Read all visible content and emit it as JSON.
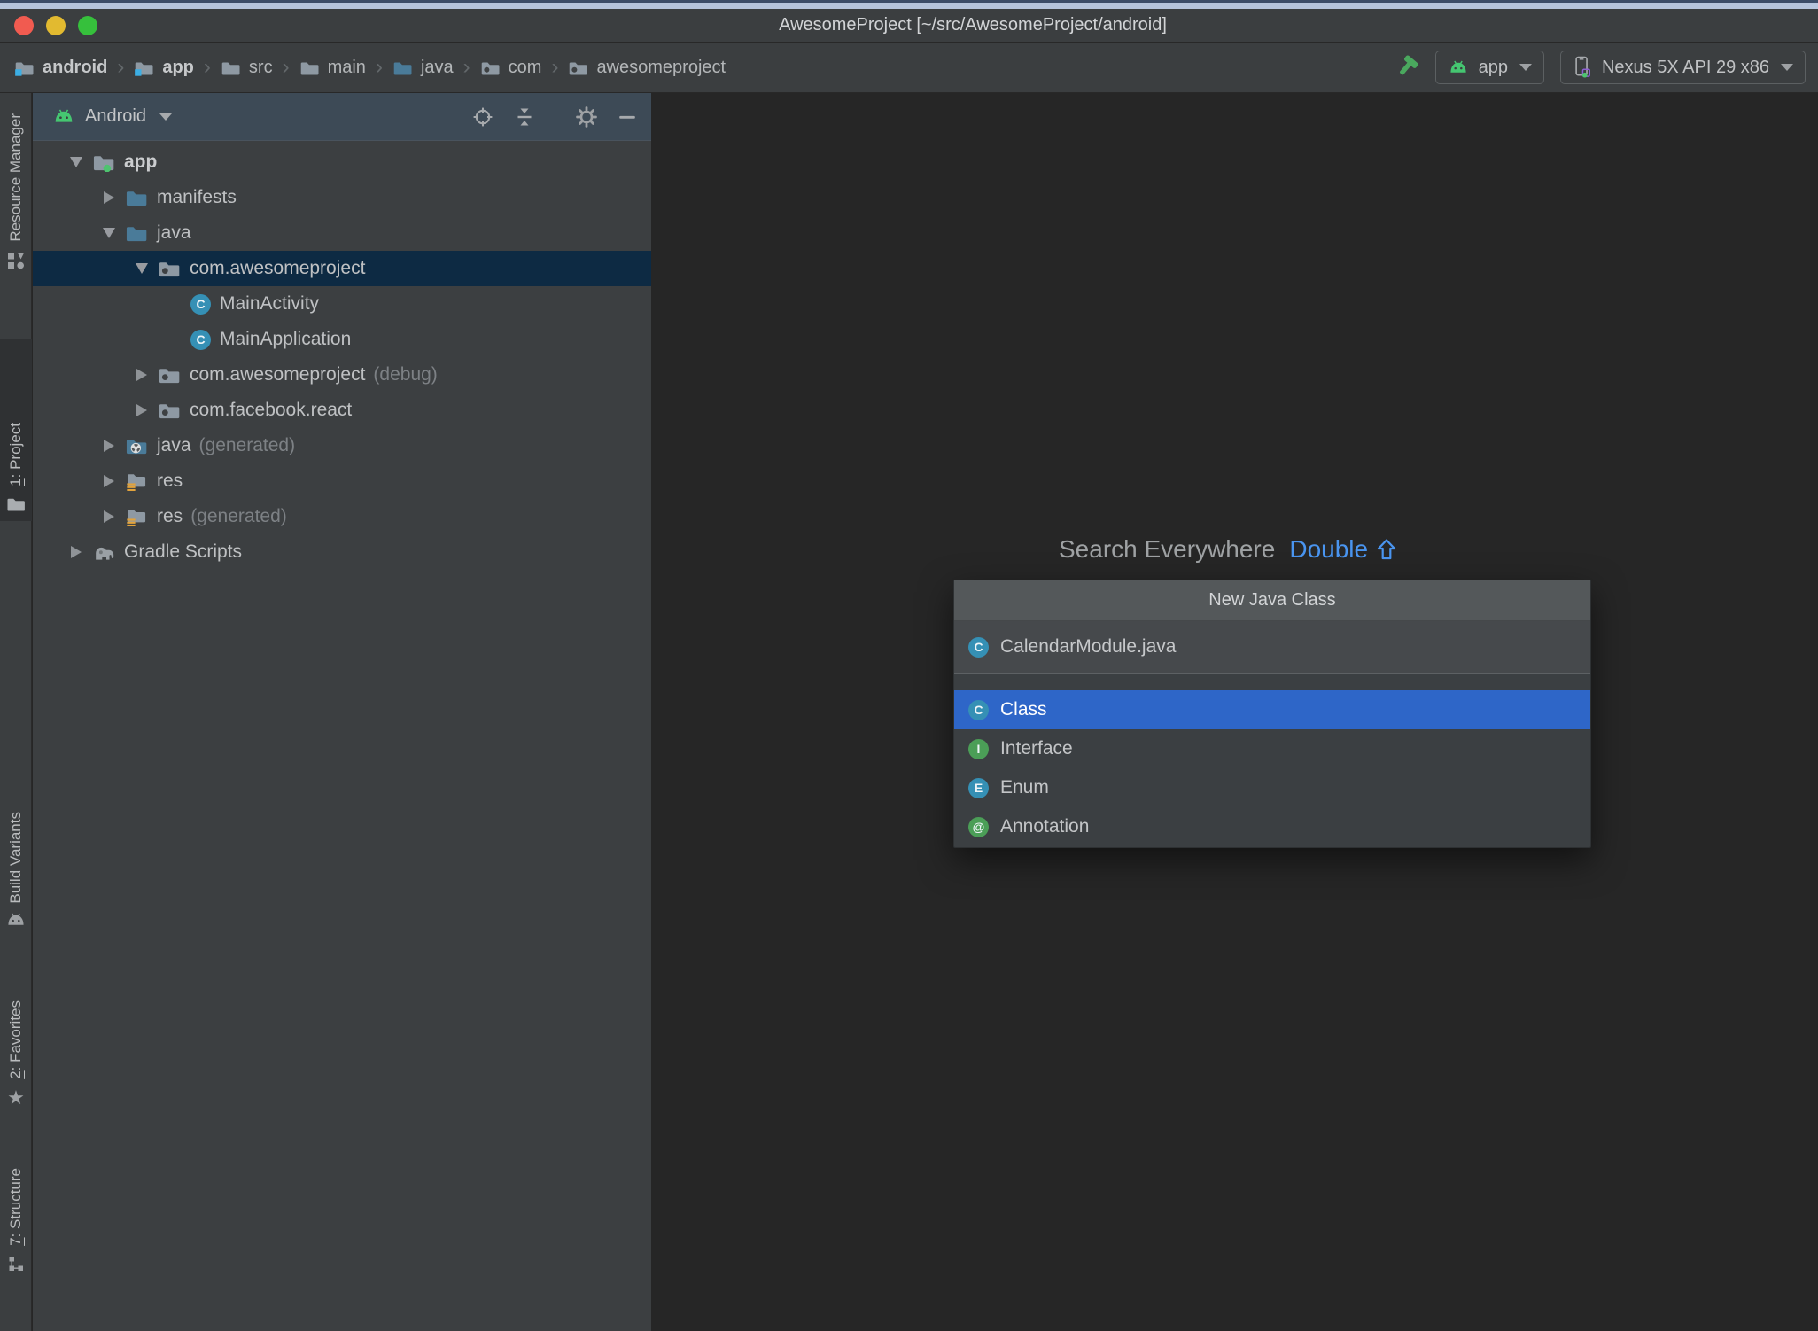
{
  "window": {
    "title": "AwesomeProject [~/src/AwesomeProject/android]"
  },
  "breadcrumb": {
    "separator": "›",
    "items": [
      {
        "label": "android",
        "icon": "folder-module",
        "bold": true
      },
      {
        "label": "app",
        "icon": "folder-module",
        "bold": true
      },
      {
        "label": "src",
        "icon": "folder-gray",
        "bold": false
      },
      {
        "label": "main",
        "icon": "folder-gray",
        "bold": false
      },
      {
        "label": "java",
        "icon": "folder-teal",
        "bold": false
      },
      {
        "label": "com",
        "icon": "folder-package",
        "bold": false
      },
      {
        "label": "awesomeproject",
        "icon": "folder-package",
        "bold": false
      }
    ]
  },
  "toolbar": {
    "run_config": {
      "label": "app"
    },
    "device": {
      "label": "Nexus 5X API 29 x86"
    }
  },
  "tool_window_bar": {
    "top_items": [
      {
        "label": "Resource Manager",
        "underline_first": false,
        "active": false
      },
      {
        "label": "1: Project",
        "underline_first": true,
        "active": true
      }
    ],
    "bottom_items": [
      {
        "label": "Build Variants",
        "underline_first": false,
        "active": false
      },
      {
        "label": "2: Favorites",
        "underline_first": true,
        "active": false
      },
      {
        "label": "7: Structure",
        "underline_first": true,
        "active": false
      }
    ]
  },
  "project_panel": {
    "view_selector": "Android",
    "tree": [
      {
        "label": "app",
        "suffix": "",
        "icon": "folder-app",
        "state": "expanded",
        "depth": 0,
        "selected": false,
        "bold": true
      },
      {
        "label": "manifests",
        "suffix": "",
        "icon": "folder-teal",
        "state": "collapsed",
        "depth": 1,
        "selected": false,
        "bold": false
      },
      {
        "label": "java",
        "suffix": "",
        "icon": "folder-teal",
        "state": "expanded",
        "depth": 1,
        "selected": false,
        "bold": false
      },
      {
        "label": "com.awesomeproject",
        "suffix": "",
        "icon": "folder-package",
        "state": "expanded",
        "depth": 2,
        "selected": true,
        "bold": false
      },
      {
        "label": "MainActivity",
        "suffix": "",
        "icon": "class",
        "state": "leaf",
        "depth": 3,
        "selected": false,
        "bold": false
      },
      {
        "label": "MainApplication",
        "suffix": "",
        "icon": "class",
        "state": "leaf",
        "depth": 3,
        "selected": false,
        "bold": false
      },
      {
        "label": "com.awesomeproject",
        "suffix": "(debug)",
        "icon": "folder-package",
        "state": "collapsed",
        "depth": 2,
        "selected": false,
        "bold": false
      },
      {
        "label": "com.facebook.react",
        "suffix": "",
        "icon": "folder-package",
        "state": "collapsed",
        "depth": 2,
        "selected": false,
        "bold": false
      },
      {
        "label": "java",
        "suffix": "(generated)",
        "icon": "folder-gen",
        "state": "collapsed",
        "depth": 1,
        "selected": false,
        "bold": false
      },
      {
        "label": "res",
        "suffix": "",
        "icon": "folder-res",
        "state": "collapsed",
        "depth": 1,
        "selected": false,
        "bold": false
      },
      {
        "label": "res",
        "suffix": "(generated)",
        "icon": "folder-res",
        "state": "collapsed",
        "depth": 1,
        "selected": false,
        "bold": false
      },
      {
        "label": "Gradle Scripts",
        "suffix": "",
        "icon": "gradle",
        "state": "collapsed",
        "depth": 0,
        "selected": false,
        "bold": false
      }
    ]
  },
  "editor": {
    "hint_text": "Search Everywhere",
    "hint_shortcut": "Double"
  },
  "popup": {
    "title": "New Java Class",
    "file_row": {
      "label": "CalendarModule.java",
      "icon": "class"
    },
    "items": [
      {
        "label": "Class",
        "icon": "class",
        "selected": true
      },
      {
        "label": "Interface",
        "icon": "interface",
        "selected": false
      },
      {
        "label": "Enum",
        "icon": "enum",
        "selected": false
      },
      {
        "label": "Annotation",
        "icon": "annotation",
        "selected": false
      }
    ]
  },
  "icon_glyphs": {
    "class": {
      "letter": "C",
      "color": "#3590b5"
    },
    "interface": {
      "letter": "I",
      "color": "#4b9e57"
    },
    "enum": {
      "letter": "E",
      "color": "#3590b5"
    },
    "annotation": {
      "letter": "@",
      "color": "#4b9e57"
    }
  },
  "colors": {
    "titlebar_bg": "#3b3e40",
    "panel_header_bg": "#3d4a56",
    "tree_selection": "#0d2a43",
    "popup_selection": "#2e66c8",
    "accent_green": "#45c671",
    "hint_blue": "#4a95f0",
    "editor_bg": "#262626"
  }
}
